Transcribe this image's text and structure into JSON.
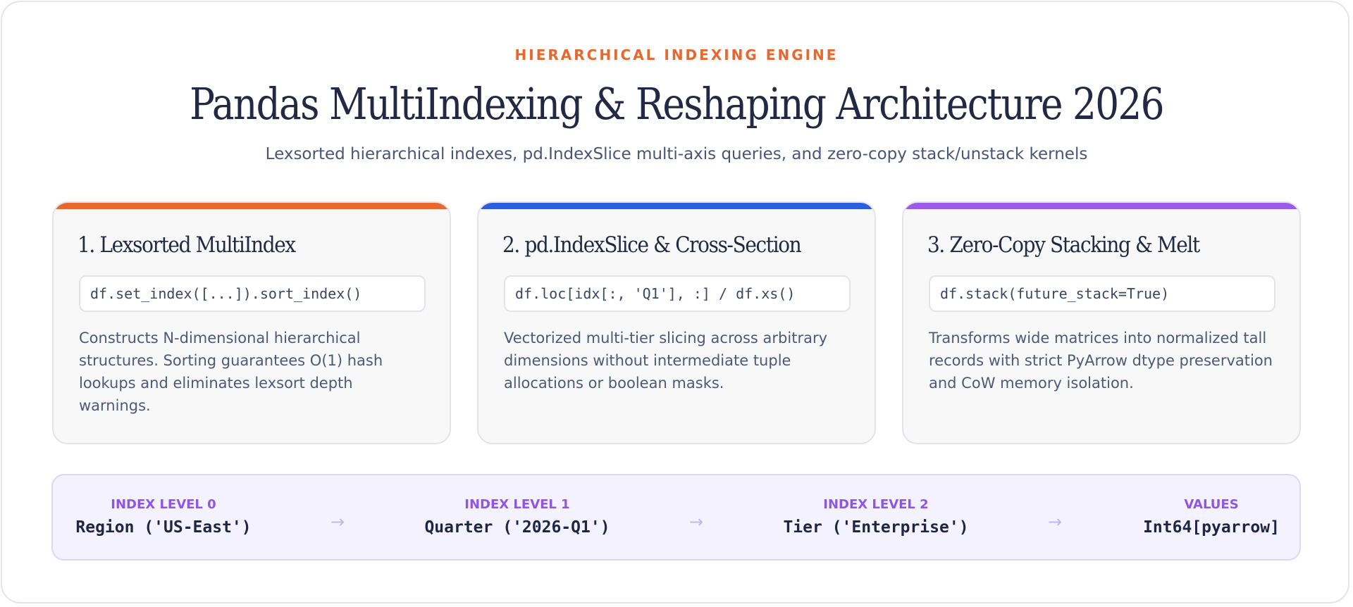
{
  "header": {
    "eyebrow": "HIERARCHICAL INDEXING ENGINE",
    "title": "Pandas MultiIndexing & Reshaping Architecture 2026",
    "subtitle": "Lexsorted hierarchical indexes, pd.IndexSlice multi-axis queries, and zero-copy stack/unstack kernels"
  },
  "cards": [
    {
      "title": "1. Lexsorted MultiIndex",
      "code": "df.set_index([...]).sort_index()",
      "description": "Constructs N-dimensional hierarchical structures. Sorting guarantees O(1) hash lookups and eliminates lexsort depth warnings.",
      "accent": "#e8672f"
    },
    {
      "title": "2. pd.IndexSlice & Cross-Section",
      "code": "df.loc[idx[:, 'Q1'], :] / df.xs()",
      "description": "Vectorized multi-tier slicing across arbitrary dimensions without intermediate tuple allocations or boolean masks.",
      "accent": "#2c5fe0"
    },
    {
      "title": "3. Zero-Copy Stacking & Melt",
      "code": "df.stack(future_stack=True)",
      "description": "Transforms wide matrices into normalized tall records with strict PyArrow dtype preservation and CoW memory isolation.",
      "accent": "#9b5be8"
    }
  ],
  "pipeline": {
    "stages": [
      {
        "label": "INDEX LEVEL 0",
        "value": "Region ('US-East')"
      },
      {
        "label": "INDEX LEVEL 1",
        "value": "Quarter ('2026-Q1')"
      },
      {
        "label": "INDEX LEVEL 2",
        "value": "Tier ('Enterprise')"
      },
      {
        "label": "VALUES",
        "value": "Int64[pyarrow]"
      }
    ],
    "arrow_icon": "→"
  }
}
